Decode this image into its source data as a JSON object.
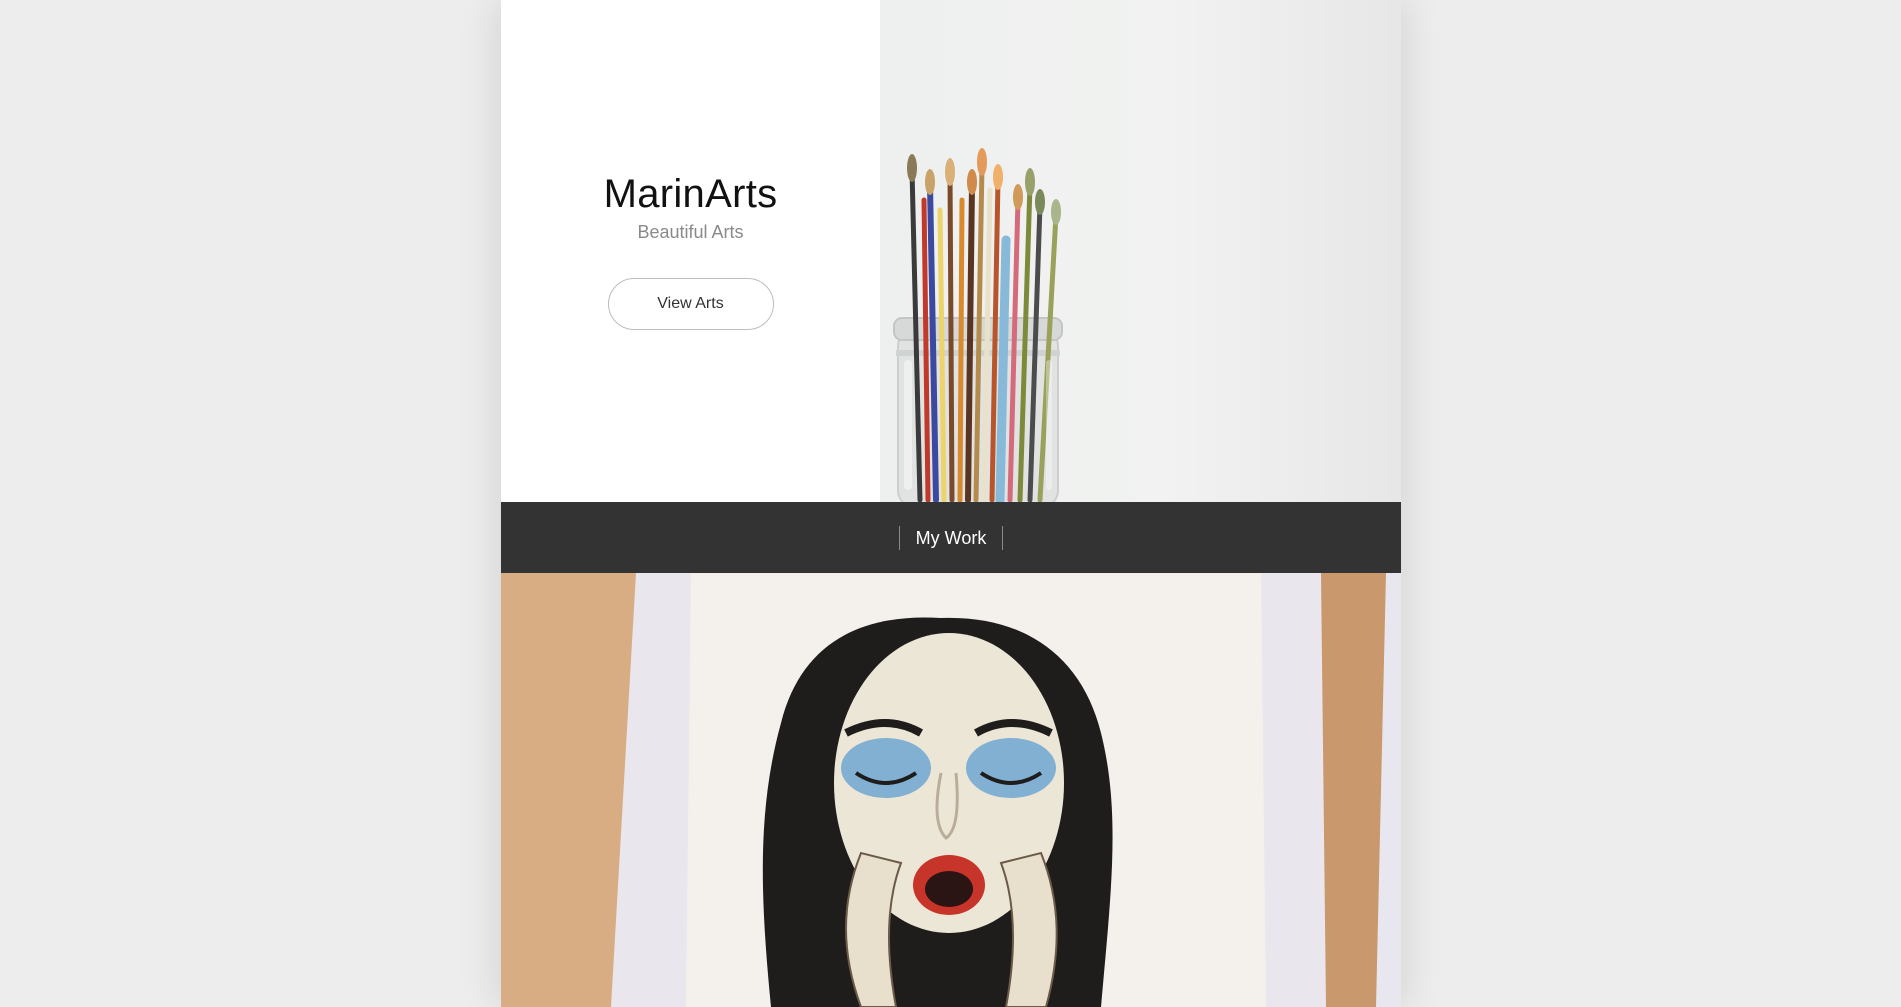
{
  "hero": {
    "title": "MarinArts",
    "subtitle": "Beautiful Arts",
    "button_label": "View Arts"
  },
  "nav": {
    "items": [
      {
        "label": "My Work"
      }
    ]
  },
  "colors": {
    "nav_background": "#333333",
    "page_background": "#ededed",
    "panel_background": "#ffffff"
  }
}
